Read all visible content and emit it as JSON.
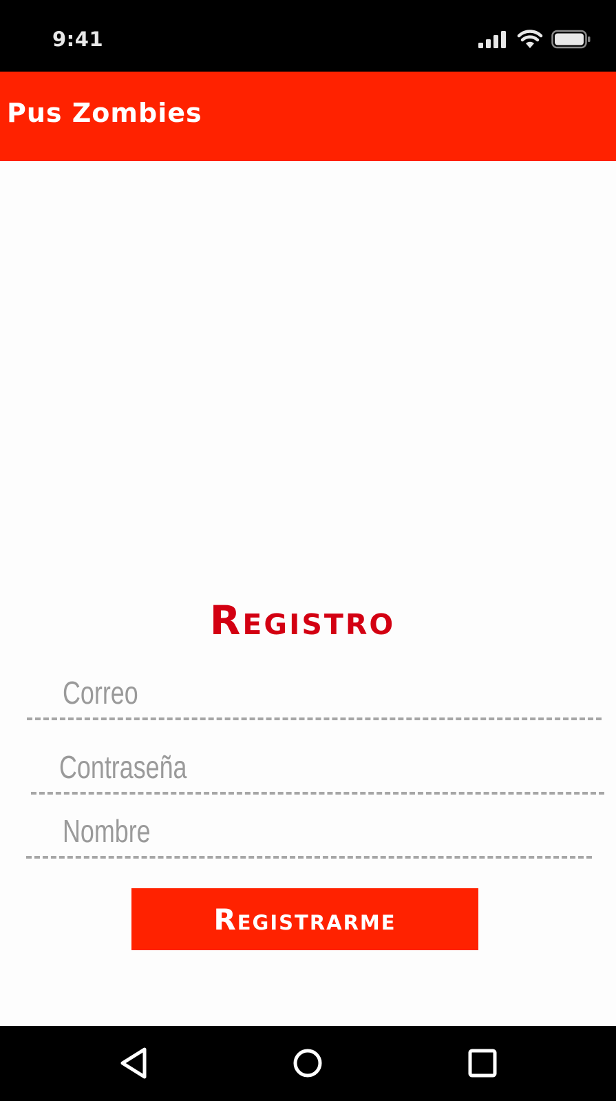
{
  "status_bar": {
    "time": "9:41",
    "icons": [
      "signal-icon",
      "wifi-icon",
      "battery-icon"
    ]
  },
  "app_bar": {
    "title": "Pus Zombies"
  },
  "form": {
    "title": "Registro",
    "fields": [
      {
        "placeholder": "Correo",
        "value": ""
      },
      {
        "placeholder": "Contraseña",
        "value": ""
      },
      {
        "placeholder": "Nombre",
        "value": ""
      }
    ],
    "submit_label": "Registrarme"
  },
  "nav_bar": {
    "icons": [
      "back-icon",
      "home-icon",
      "recents-icon"
    ]
  },
  "colors": {
    "primary": "#ff2200",
    "title": "#d30012",
    "placeholder": "#9a9a9a",
    "underline": "#a6a6a6",
    "system_bars": "#000000"
  }
}
